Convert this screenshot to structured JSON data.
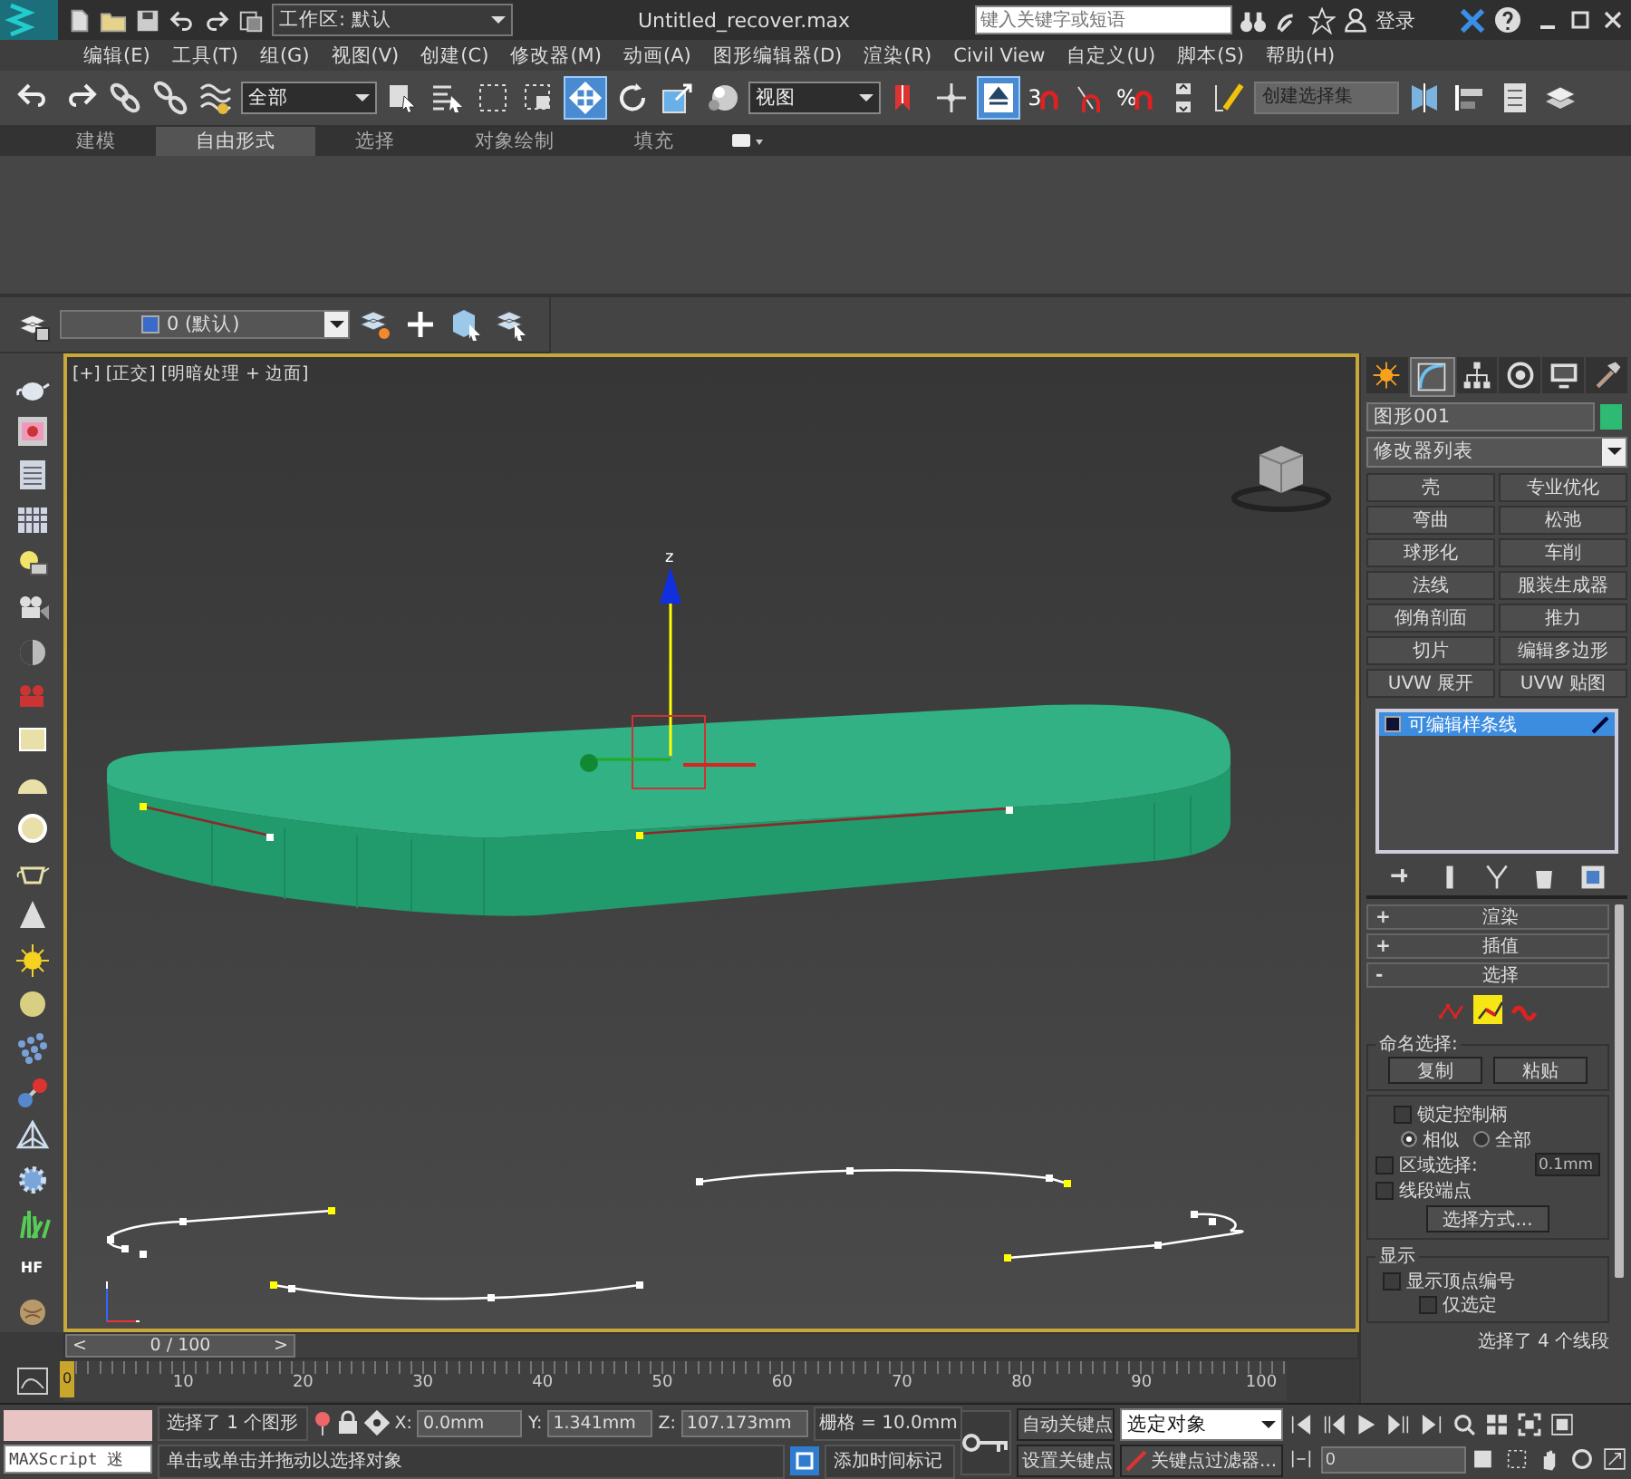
{
  "title_bar": {
    "workspace": "工作区: 默认",
    "title": "Untitled_recover.max",
    "search": {
      "placeholder": "键入关键字或短语"
    },
    "login": "登录"
  },
  "menu": [
    "编辑(E)",
    "工具(T)",
    "组(G)",
    "视图(V)",
    "创建(C)",
    "修改器(M)",
    "动画(A)",
    "图形编辑器(D)",
    "渲染(R)",
    "Civil View",
    "自定义(U)",
    "脚本(S)",
    "帮助(H)"
  ],
  "main_toolbar": {
    "selection_filter": "全部",
    "reference_coord": "视图",
    "snap_toggle": "3",
    "percent_snap": "%",
    "selection_set": "创建选择集"
  },
  "ribbon": {
    "tabs": [
      {
        "label": "建模",
        "selected": false
      },
      {
        "label": "自由形式",
        "selected": true
      },
      {
        "label": "选择",
        "selected": false
      },
      {
        "label": "对象绘制",
        "selected": false
      },
      {
        "label": "填充",
        "selected": false
      }
    ]
  },
  "layer_toolbar": {
    "layer": "0 (默认)"
  },
  "left_toolbar": {
    "hair_label": "HF"
  },
  "viewport": {
    "label": "[+] [正交] [明暗处理 + 边面]",
    "gizmo_axis": "z"
  },
  "command_panel": {
    "tabs": [
      {
        "kind": "create",
        "selected": false
      },
      {
        "kind": "modify",
        "selected": true
      },
      {
        "kind": "hierarchy",
        "selected": false
      },
      {
        "kind": "motion",
        "selected": false
      },
      {
        "kind": "display",
        "selected": false
      },
      {
        "kind": "utilities",
        "selected": false
      }
    ],
    "object_name": "图形001",
    "modifier_list": "修改器列表",
    "modifier_buttons": [
      "壳",
      "专业优化",
      "弯曲",
      "松弛",
      "球形化",
      "车削",
      "法线",
      "服装生成器",
      "倒角剖面",
      "推力",
      "切片",
      "编辑多边形",
      "UVW 展开",
      "UVW 贴图"
    ],
    "stack": [
      {
        "label": "可编辑样条线",
        "selected": true
      }
    ],
    "rollouts": [
      {
        "toggle": "+",
        "title": "渲染"
      },
      {
        "toggle": "+",
        "title": "插值"
      },
      {
        "toggle": "-",
        "title": "选择"
      }
    ],
    "selection": {
      "levels": [
        {
          "kind": "vertex",
          "selected": false
        },
        {
          "kind": "segment",
          "selected": true
        },
        {
          "kind": "spline",
          "selected": false
        }
      ],
      "named_label": "命名选择:",
      "named_buttons": [
        "复制",
        "粘贴"
      ],
      "lock_handles": {
        "label": "锁定控制柄",
        "checked": false
      },
      "radios": [
        {
          "label": "相似",
          "selected": true
        },
        {
          "label": "全部",
          "selected": false
        }
      ],
      "area_selection": {
        "label": "区域选择:",
        "checked": false,
        "value": "0.1mm"
      },
      "segment_end": {
        "label": "线段端点",
        "checked": false
      },
      "select_by": "选择方式...",
      "display_label": "显示",
      "show_vertex_numbers": {
        "label": "显示顶点编号",
        "checked": false
      },
      "selected_only": {
        "label": "仅选定",
        "checked": false
      },
      "status": "选择了 4 个线段"
    }
  },
  "time_slider": {
    "prev": "<",
    "label": "0 / 100",
    "next": ">",
    "level": 0
  },
  "track_bar": {
    "marker": "0",
    "ticks": [
      "10",
      "20",
      "30",
      "40",
      "50",
      "60",
      "70",
      "80",
      "90",
      "100"
    ]
  },
  "status_bar": {
    "maxscript": "MAXScript 迷",
    "selection_info": "选择了 1 个图形",
    "prompt": "单击或单击并拖动以选择对象",
    "coords": [
      {
        "axis": "X:",
        "value": "0.0mm"
      },
      {
        "axis": "Y:",
        "value": "1.341mm"
      },
      {
        "axis": "Z:",
        "value": "107.173mm"
      }
    ],
    "grid": "栅格 = 10.0mm",
    "add_time_tag": "添加时间标记",
    "auto_key": "自动关键点",
    "set_key": "设置关键点",
    "key_mode": "选定对象",
    "key_filters": "关键点过滤器...",
    "frame": "0"
  }
}
